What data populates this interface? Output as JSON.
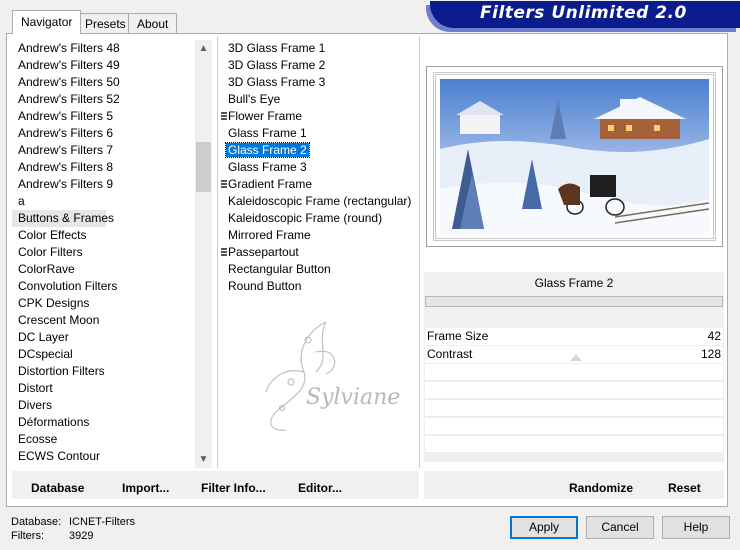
{
  "tabs": [
    "Navigator",
    "Presets",
    "About"
  ],
  "banner": {
    "title": "Filters Unlimited 2.0"
  },
  "categories": {
    "items": [
      "Andrew's Filters 48",
      "Andrew's Filters 49",
      "Andrew's Filters 50",
      "Andrew's Filters 52",
      "Andrew's Filters 5",
      "Andrew's Filters 6",
      "Andrew's Filters 7",
      "Andrew's Filters 8",
      "Andrew's Filters 9",
      "a",
      "Buttons & Frames",
      "Color Effects",
      "Color Filters",
      "ColorRave",
      "Convolution Filters",
      "CPK Designs",
      "Crescent Moon",
      "DC Layer",
      "DCspecial",
      "Distortion Filters",
      "Distort",
      "Divers",
      "Déformations",
      "Ecosse",
      "ECWS Contour"
    ],
    "selected": "Buttons & Frames"
  },
  "filters": {
    "items": [
      "3D Glass Frame 1",
      "3D Glass Frame 2",
      "3D Glass Frame 3",
      "Bull's Eye",
      "Flower Frame",
      "Glass Frame 1",
      "Glass Frame 2",
      "Glass Frame 3",
      "Gradient Frame",
      "Kaleidoscopic Frame (rectangular)",
      "Kaleidoscopic Frame (round)",
      "Mirrored Frame",
      "Passepartout",
      "Rectangular Button",
      "Round Button"
    ],
    "selected": "Glass Frame 2",
    "folder_items": [
      "Flower Frame",
      "Gradient Frame",
      "Passepartout"
    ]
  },
  "watermark": {
    "text": "Sylviane"
  },
  "params": {
    "filter_name": "Glass Frame 2",
    "rows": [
      {
        "label": "Frame Size",
        "value": "42"
      },
      {
        "label": "Contrast",
        "value": "128"
      }
    ]
  },
  "toolbar": {
    "database": "Database",
    "import": "Import...",
    "filter_info": "Filter Info...",
    "editor": "Editor...",
    "randomize": "Randomize",
    "reset": "Reset"
  },
  "status": {
    "database_label": "Database:",
    "database_value": "ICNET-Filters",
    "filters_label": "Filters:",
    "filters_value": "3929"
  },
  "dialog": {
    "apply": "Apply",
    "cancel": "Cancel",
    "help": "Help"
  },
  "colors": {
    "banner": "#0d1c8c",
    "selection": "#0078d7"
  }
}
